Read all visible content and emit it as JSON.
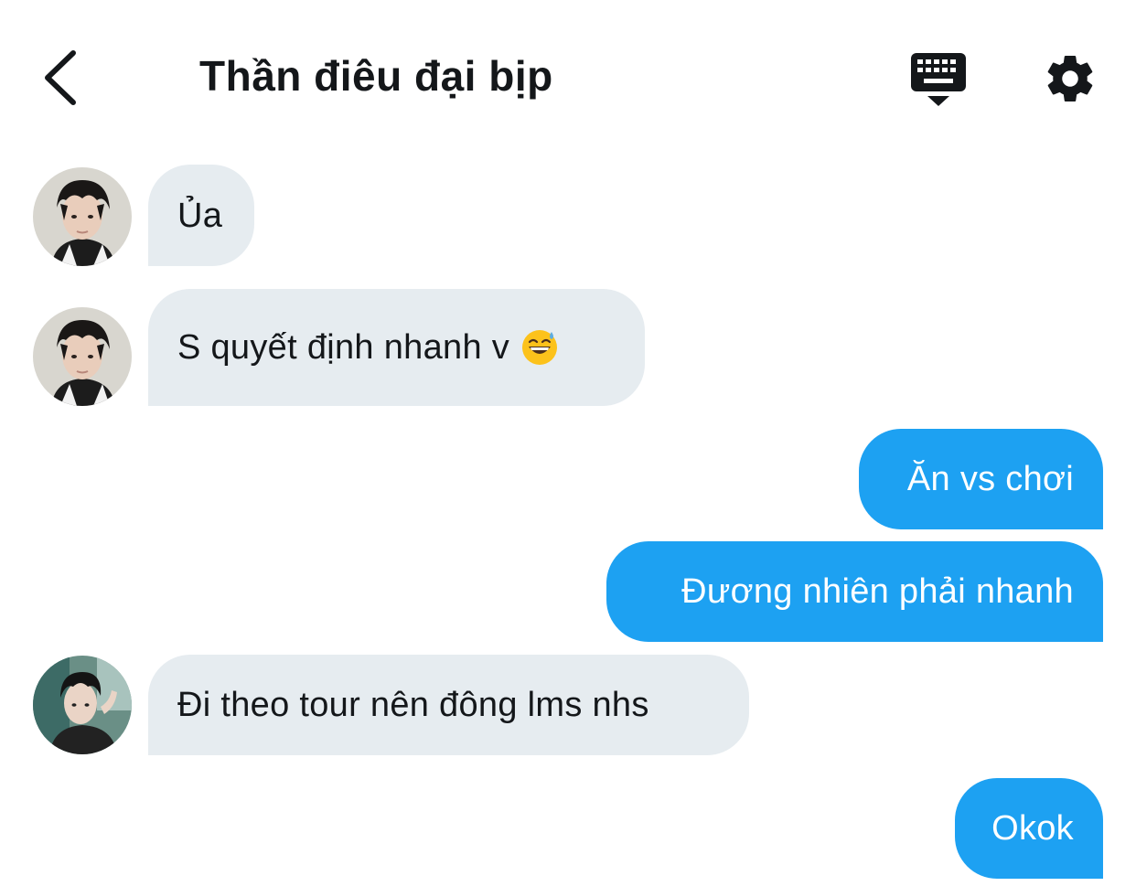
{
  "header": {
    "title": "Thần điêu đại bịp",
    "back_icon": "chevron-left-icon",
    "keyboard_icon": "keyboard-hide-icon",
    "settings_icon": "gear-icon"
  },
  "messages": [
    {
      "side": "in",
      "text": "Ủa",
      "avatar": "avatar-1"
    },
    {
      "side": "in",
      "text": "S quyết định nhanh v",
      "emoji": "grinning-sweat-emoji",
      "avatar": "avatar-1"
    },
    {
      "side": "out",
      "text": "Ăn vs chơi"
    },
    {
      "side": "out",
      "text": "Đương nhiên phải nhanh"
    },
    {
      "side": "in",
      "text": "Đi theo tour nên đông lms nhs",
      "avatar": "avatar-2"
    },
    {
      "side": "out",
      "text": "Okok"
    }
  ],
  "colors": {
    "incoming_bubble": "#e6ecf0",
    "outgoing_bubble": "#1da1f2",
    "text": "#14171a",
    "outgoing_text": "#ffffff"
  }
}
